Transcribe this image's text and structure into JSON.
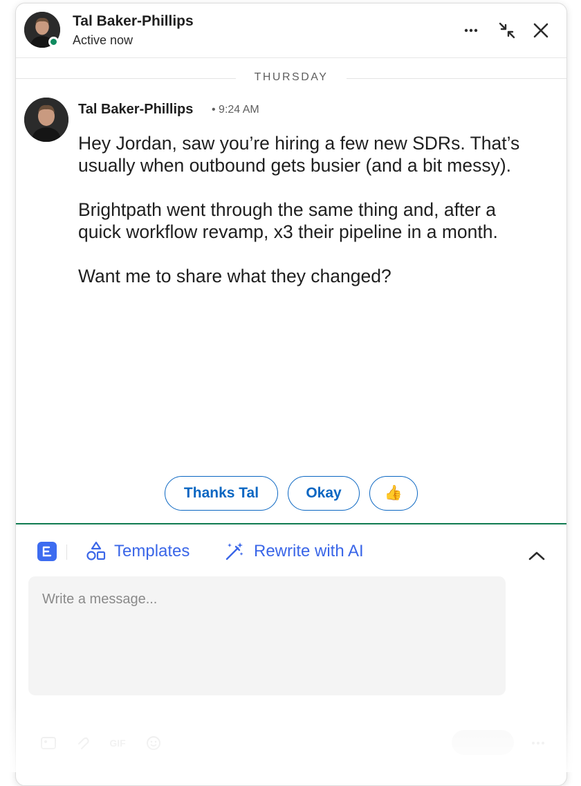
{
  "header": {
    "name": "Tal Baker-Phillips",
    "status": "Active now",
    "icons": [
      "more-icon",
      "minimize-icon",
      "close-icon"
    ]
  },
  "thread": {
    "date_divider": "THURSDAY",
    "message": {
      "sender": "Tal Baker-Phillips",
      "time": "• 9:24 AM",
      "paragraphs": [
        "Hey Jordan, saw you’re hiring a few new SDRs. That’s usually when outbound gets busier (and a bit messy).",
        "Brightpath went through the same thing and, after a quick workflow revamp, x3 their pipeline in a month.",
        "Want me to share what they changed?"
      ]
    }
  },
  "quick_replies": [
    "Thanks Tal",
    "Okay",
    "👍"
  ],
  "composer": {
    "templates_label": "Templates",
    "rewrite_label": "Rewrite with AI",
    "placeholder": "Write a message...",
    "gif_label": "GIF"
  },
  "colors": {
    "accent_blue": "#0a66c2",
    "tool_blue": "#3a66e8",
    "online_green": "#0f8a5f",
    "composer_divider": "#0f7a50"
  }
}
